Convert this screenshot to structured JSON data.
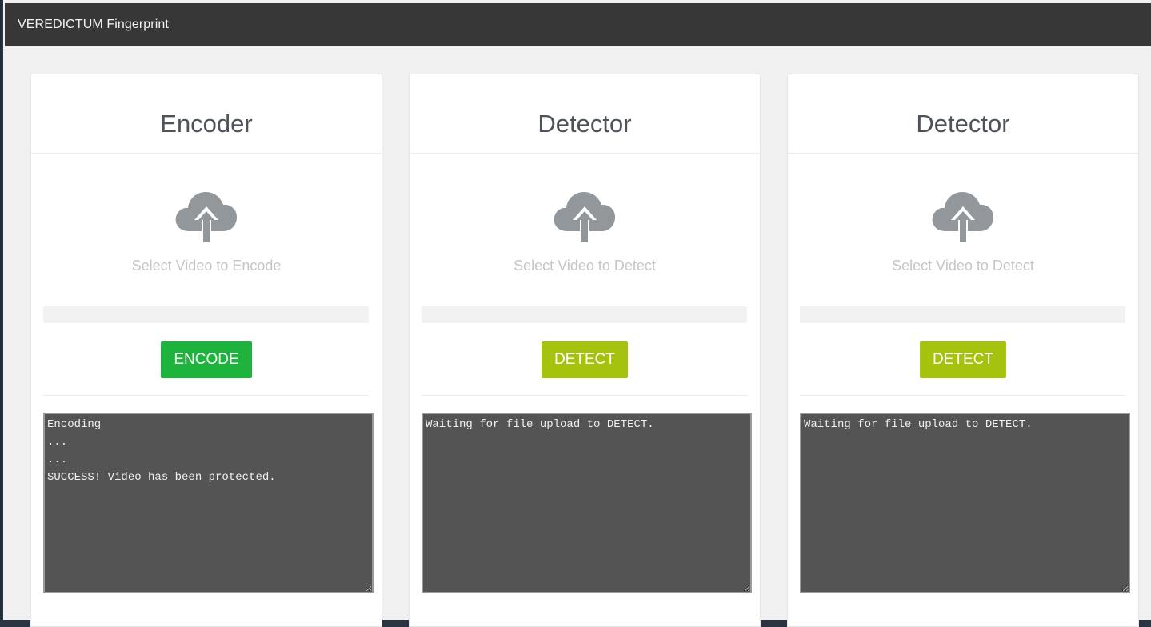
{
  "app": {
    "brand": "VEREDICTUM Fingerprint"
  },
  "colors": {
    "navbar": "#373737",
    "encode_button": "#1db33d",
    "detect_button": "#a5c20f",
    "console_bg": "#545454",
    "page_bg": "#f1f1f1"
  },
  "panels": [
    {
      "title": "Encoder",
      "icon": "cloud-upload-icon",
      "upload_label": "Select Video to Encode",
      "button_label": "ENCODE",
      "console_text": "Encoding\n...\n...\nSUCCESS! Video has been protected."
    },
    {
      "title": "Detector",
      "icon": "cloud-upload-icon",
      "upload_label": "Select Video to Detect",
      "button_label": "DETECT",
      "console_text": "Waiting for file upload to DETECT."
    },
    {
      "title": "Detector",
      "icon": "cloud-upload-icon",
      "upload_label": "Select Video to Detect",
      "button_label": "DETECT",
      "console_text": "Waiting for file upload to DETECT."
    }
  ]
}
